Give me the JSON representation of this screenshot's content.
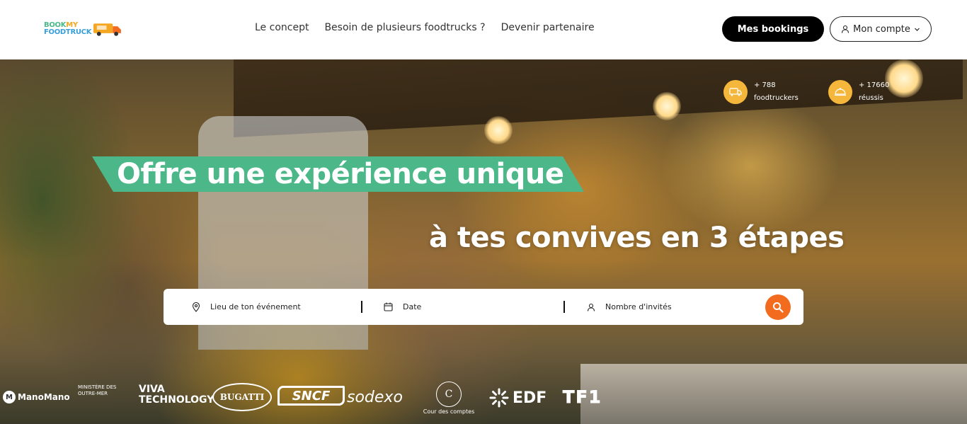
{
  "header": {
    "logo": {
      "line1_a": "BOOK",
      "line1_b": "MY",
      "line2": "FOODTRUCK"
    },
    "nav": [
      "Le concept",
      "Besoin de plusieurs foodtrucks ?",
      "Devenir partenaire"
    ],
    "bookings_label": "Mes bookings",
    "account_label": "Mon compte",
    "icons": {
      "account": "user-icon",
      "dropdown": "chevron-down-icon",
      "logo": "foodtruck-icon"
    }
  },
  "stats": [
    {
      "value": "+ 788",
      "label": "foodtruckers",
      "icon": "truck-icon"
    },
    {
      "value": "+ 17660",
      "label": "réussis",
      "icon": "cloche-icon"
    }
  ],
  "hero": {
    "headline_1": "Offre une expérience unique",
    "headline_2": "à tes convives en 3 étapes"
  },
  "search": {
    "location_placeholder": "Lieu de ton événement",
    "date_placeholder": "Date",
    "guests_placeholder": "Nombre d'invités",
    "icons": {
      "location": "map-pin-icon",
      "date": "calendar-icon",
      "guests": "user-icon",
      "submit": "search-icon"
    }
  },
  "partners": [
    {
      "name": "ManoMano"
    },
    {
      "name": "MINISTÈRE DES OUTRE-MER"
    },
    {
      "name": "VIVA TECHNOLOGY"
    },
    {
      "name": "BUGATTI"
    },
    {
      "name": "SNCF"
    },
    {
      "name": "sodexo"
    },
    {
      "name": "Cour des comptes"
    },
    {
      "name": "EDF"
    },
    {
      "name": "TF1"
    }
  ],
  "colors": {
    "accent_green": "#4cb88a",
    "accent_orange": "#f26b1f",
    "stat_yellow": "#f5b73b",
    "dark": "#000000"
  }
}
